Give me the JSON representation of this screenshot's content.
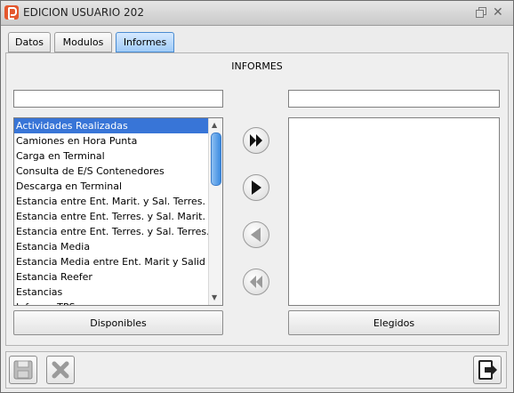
{
  "window": {
    "title": "EDICION USUARIO 202"
  },
  "tabs": [
    {
      "label": "Datos",
      "active": false
    },
    {
      "label": "Modulos",
      "active": false
    },
    {
      "label": "Informes",
      "active": true
    }
  ],
  "section": {
    "title": "INFORMES"
  },
  "available": {
    "filter_value": "",
    "items": [
      "Actividades Realizadas",
      "Camiones en Hora Punta",
      "Carga en Terminal",
      "Consulta de E/S Contenedores",
      "Descarga en Terminal",
      "Estancia entre Ent. Marit. y Sal. Terres.",
      "Estancia entre Ent. Terres. y Sal. Marit.",
      "Estancia entre Ent. Terres. y Sal. Terres.",
      "Estancia Media",
      "Estancia Media entre Ent. Marit y Salid",
      "Estancia Reefer",
      "Estancias",
      "Informe TPS"
    ],
    "selected_index": 0,
    "button_label": "Disponibles"
  },
  "chosen": {
    "filter_value": "",
    "items": [],
    "button_label": "Elegidos"
  },
  "transfer_buttons": [
    {
      "icon": "double-arrow-right-icon",
      "enabled": true
    },
    {
      "icon": "arrow-right-icon",
      "enabled": true
    },
    {
      "icon": "arrow-left-icon",
      "enabled": false
    },
    {
      "icon": "double-arrow-left-icon",
      "enabled": false
    }
  ],
  "footer": {
    "save_icon": "save-icon",
    "cancel_icon": "cancel-icon",
    "exit_icon": "exit-icon"
  },
  "colors": {
    "selection": "#3875d7",
    "active_tab": "#9fcbf7",
    "app_icon": "#e4572e"
  }
}
